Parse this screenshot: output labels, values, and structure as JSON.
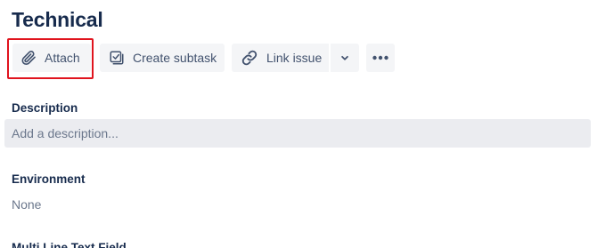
{
  "issue": {
    "title": "Technical"
  },
  "toolbar": {
    "attach_label": "Attach",
    "create_subtask_label": "Create subtask",
    "link_issue_label": "Link issue",
    "icons": {
      "attach": "paperclip-icon",
      "create_subtask": "subtask-checkbox-icon",
      "link_issue": "link-icon",
      "dropdown": "chevron-down-icon",
      "more": "more-horizontal-icon"
    },
    "highlight_color": "#e0141e"
  },
  "fields": {
    "description": {
      "label": "Description",
      "placeholder": "Add a description..."
    },
    "environment": {
      "label": "Environment",
      "value": "None"
    },
    "multi_line_text_field": {
      "label": "Multi Line Text Field"
    }
  },
  "colors": {
    "heading": "#172b4d",
    "button_bg": "#f4f5f7",
    "button_text": "#42526e",
    "input_bg": "#ebecf0",
    "muted_text": "#6b778c"
  }
}
